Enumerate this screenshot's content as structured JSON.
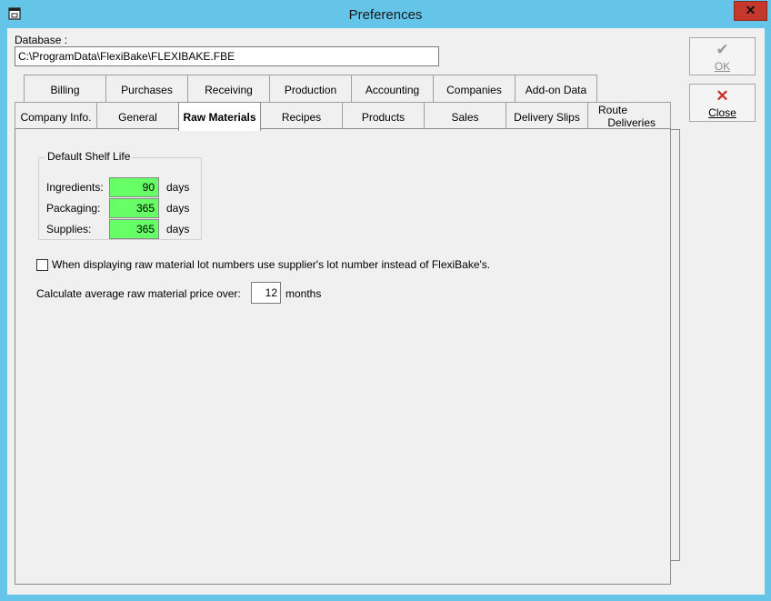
{
  "window": {
    "title": "Preferences",
    "close_glyph": "✕",
    "icon": "window-doc-icon"
  },
  "database": {
    "label": "Database :",
    "path": "C:\\ProgramData\\FlexiBake\\FLEXIBAKE.FBE"
  },
  "buttons": {
    "ok": {
      "label": "OK",
      "glyph": "✔",
      "enabled": false
    },
    "close": {
      "label": "Close",
      "glyph": "✕"
    }
  },
  "tabs_back": [
    "Billing",
    "Purchases",
    "Receiving",
    "Production",
    "Accounting",
    "Companies",
    "Add-on Data"
  ],
  "tabs_front": [
    "Company Info.",
    "General",
    "Raw Materials",
    "Recipes",
    "Products",
    "Sales",
    "Delivery Slips",
    "Route",
    "Deliveries"
  ],
  "active_tab": "Raw Materials",
  "shelf_life": {
    "title": "Default Shelf Life",
    "unit": "days",
    "rows": [
      {
        "label": "Ingredients:",
        "value": "90"
      },
      {
        "label": "Packaging:",
        "value": "365"
      },
      {
        "label": "Supplies:",
        "value": "365"
      }
    ],
    "field_color": "#66ff66"
  },
  "lot_option": {
    "label": "When displaying raw material lot numbers use supplier's lot number instead of FlexiBake's.",
    "checked": false
  },
  "avg_price": {
    "label": "Calculate average raw material price over:",
    "value": "12",
    "unit": "months"
  },
  "colors": {
    "title_bar": "#64c5e8",
    "close_button": "#c7382c",
    "face": "#f0f0f0"
  }
}
